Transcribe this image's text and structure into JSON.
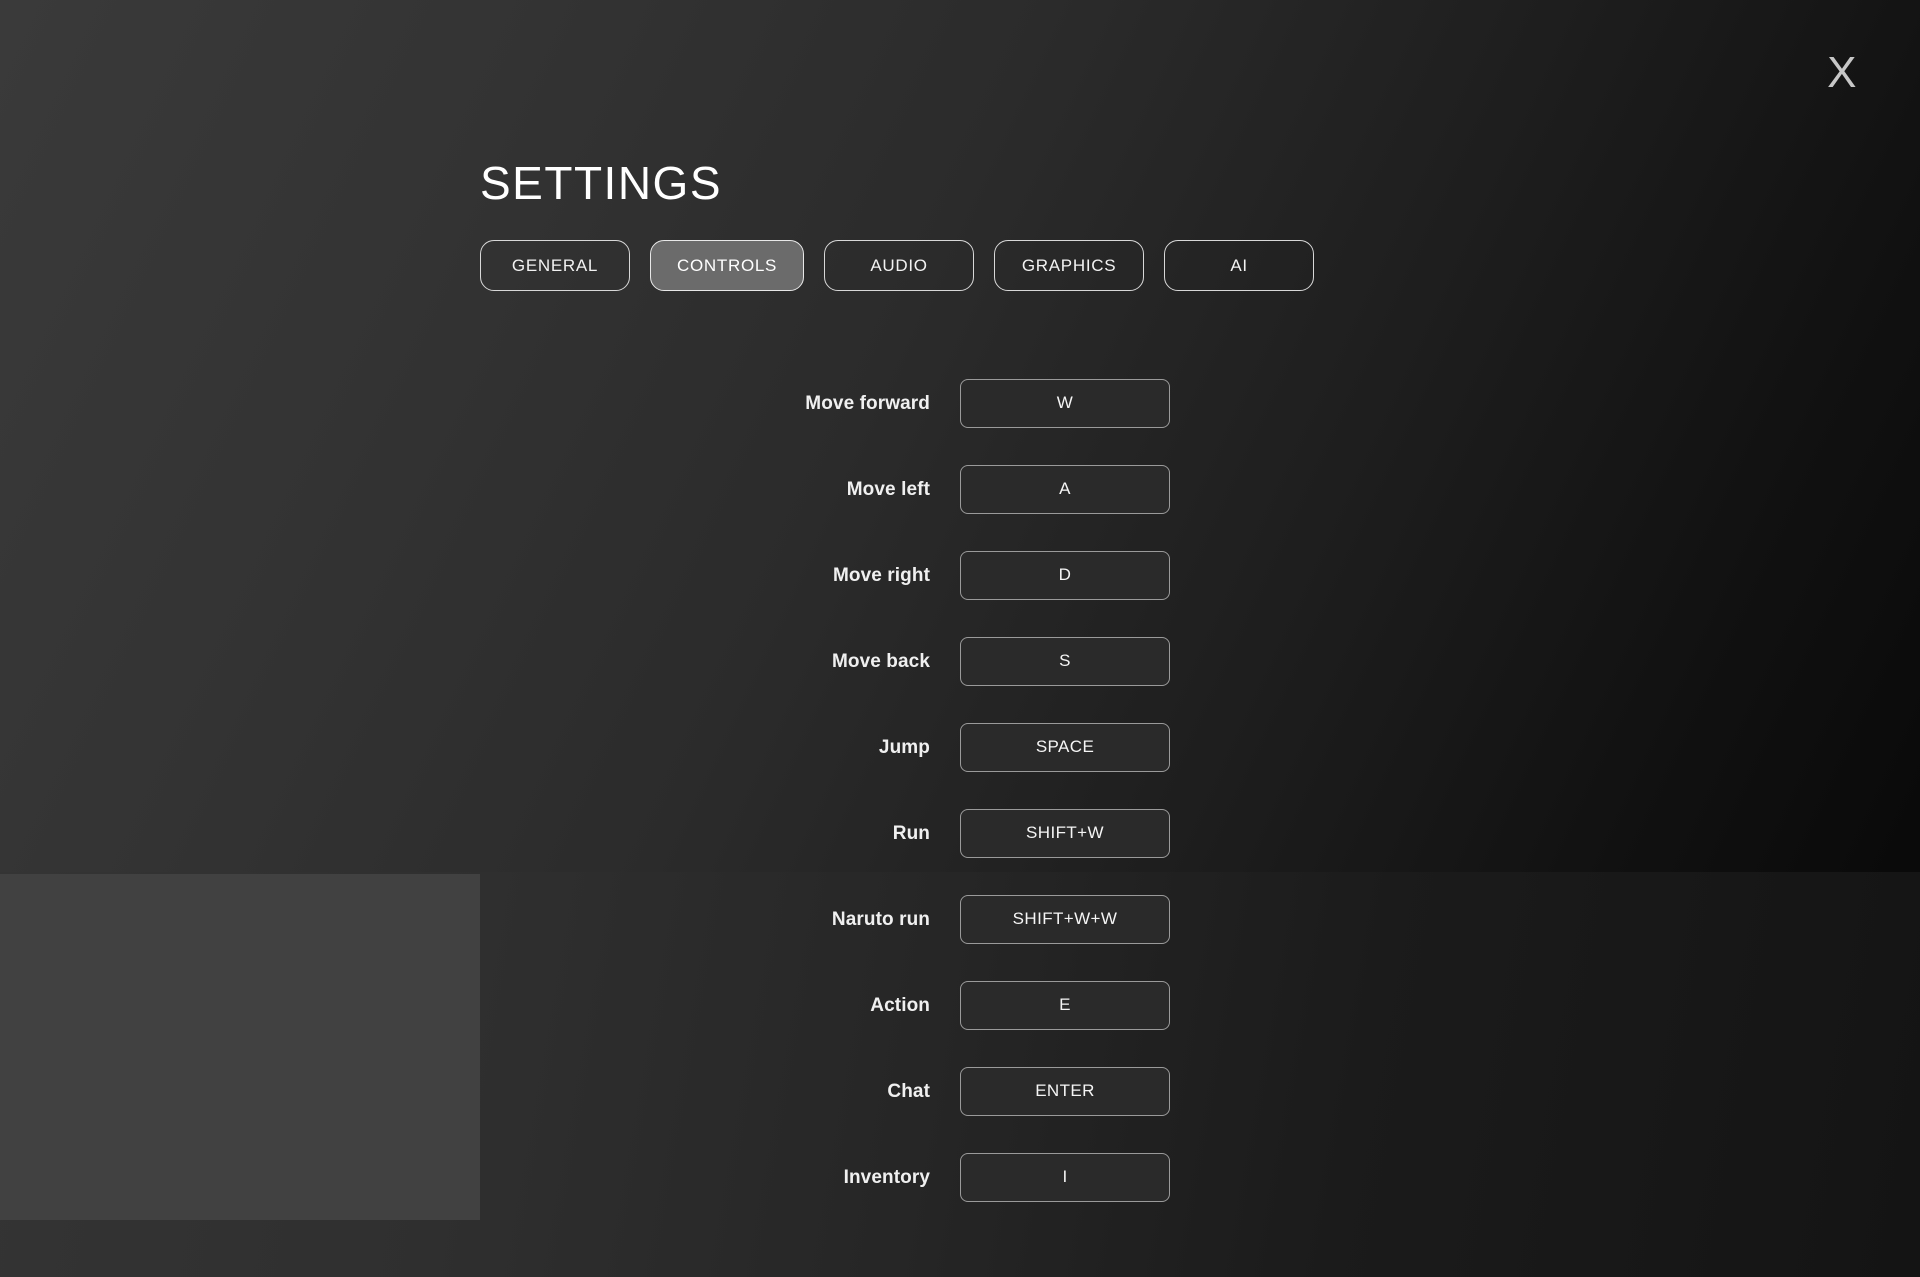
{
  "window": {
    "title": "SETTINGS",
    "close_label": "X",
    "close_icon": "close-x-icon"
  },
  "theme": {
    "background_top_left": "#3a3a3a",
    "background_bottom_right": "#050505",
    "panel_highlight": "#414141",
    "tab_active_fill": "#6b6b6b",
    "tab_border": "#d8d8d8",
    "key_button_border": "#9a9a9a",
    "key_button_fill": "#2a2a2a",
    "text_primary": "#ffffff",
    "text_close": "#c7c7c7"
  },
  "tabs": [
    {
      "label": "GENERAL",
      "active": false
    },
    {
      "label": "CONTROLS",
      "active": true
    },
    {
      "label": "AUDIO",
      "active": false
    },
    {
      "label": "GRAPHICS",
      "active": false
    },
    {
      "label": "AI",
      "active": false
    }
  ],
  "controls": {
    "bindings": [
      {
        "action": "Move forward",
        "key": "W"
      },
      {
        "action": "Move left",
        "key": "A"
      },
      {
        "action": "Move right",
        "key": "D"
      },
      {
        "action": "Move back",
        "key": "S"
      },
      {
        "action": "Jump",
        "key": "SPACE"
      },
      {
        "action": "Run",
        "key": "SHIFT+W"
      },
      {
        "action": "Naruto run",
        "key": "SHIFT+W+W"
      },
      {
        "action": "Action",
        "key": "E"
      },
      {
        "action": "Chat",
        "key": "ENTER"
      },
      {
        "action": "Inventory",
        "key": "I"
      }
    ]
  }
}
